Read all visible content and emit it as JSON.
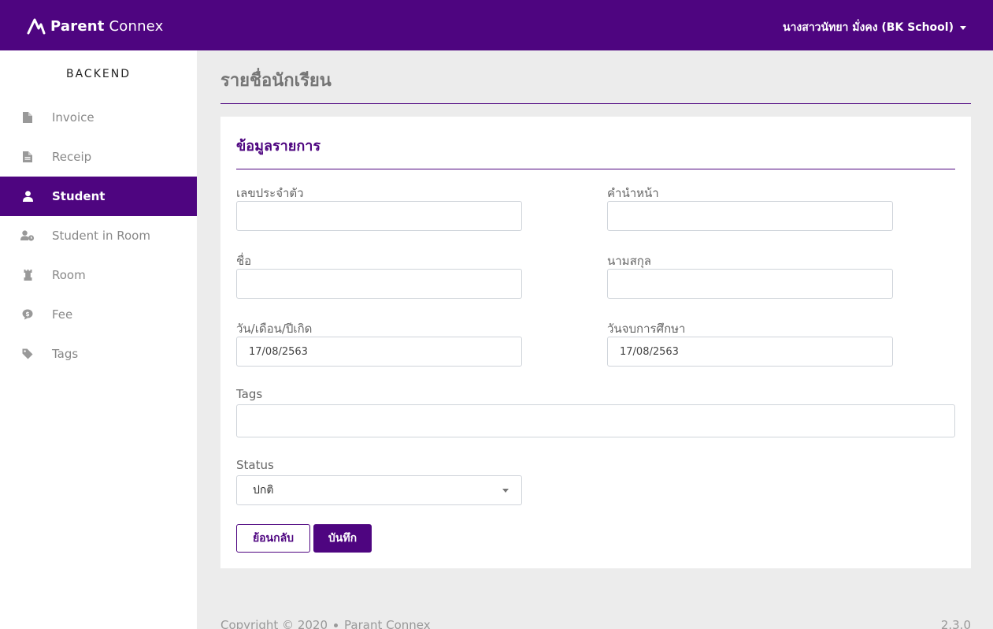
{
  "header": {
    "brand_bold": "Parent",
    "brand_light": "Connex",
    "user_name": "นางสาวนัทยา มั่งคง (BK School)"
  },
  "sidebar": {
    "title": "BACKEND",
    "items": [
      {
        "label": "Invoice",
        "icon": "file-icon",
        "active": false
      },
      {
        "label": "Receip",
        "icon": "file-text-icon",
        "active": false
      },
      {
        "label": "Student",
        "icon": "user-icon",
        "active": true
      },
      {
        "label": "Student in Room",
        "icon": "user-clock-icon",
        "active": false
      },
      {
        "label": "Room",
        "icon": "chess-rook-icon",
        "active": false
      },
      {
        "label": "Fee",
        "icon": "money-bill-icon",
        "active": false
      },
      {
        "label": "Tags",
        "icon": "tag-icon",
        "active": false
      }
    ]
  },
  "page": {
    "title": "รายชื่อนักเรียน"
  },
  "form": {
    "card_title": "ข้อมูลรายการ",
    "fields": {
      "student_id": {
        "label": "เลขประจำตัว",
        "value": ""
      },
      "prefix": {
        "label": "คำนำหน้า",
        "value": ""
      },
      "first_name": {
        "label": "ชื่อ",
        "value": ""
      },
      "last_name": {
        "label": "นามสกุล",
        "value": ""
      },
      "birth_date": {
        "label": "วัน/เดือน/ปีเกิด",
        "value": "17/08/2563"
      },
      "graduation_date": {
        "label": "วันจบการศึกษา",
        "value": "17/08/2563"
      },
      "tags": {
        "label": "Tags",
        "value": ""
      },
      "status": {
        "label": "Status",
        "value": "ปกติ"
      }
    },
    "back_label": "ย้อนกลับ",
    "save_label": "บันทึก"
  },
  "footer": {
    "copyright": "Copyright © 2020",
    "company": "Parant Connex",
    "version": "2.3.0"
  },
  "colors": {
    "brand": "#4e0580",
    "background": "#ececec"
  }
}
